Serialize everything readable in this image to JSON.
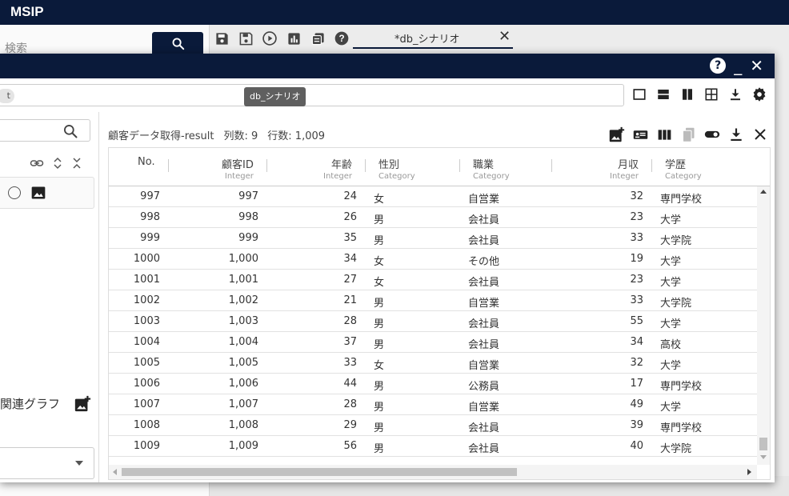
{
  "app": {
    "title": "MSIP"
  },
  "background": {
    "search_label": "検索",
    "tab": {
      "label": "*db_シナリオ",
      "close": "✕"
    }
  },
  "dialog": {
    "tooltip": "db_シナリオ",
    "breadcrumb_chip": "t",
    "header": {
      "help": "?",
      "minimize": "_",
      "close": "✕"
    },
    "left_panel": {
      "graph_label": "関連グラフ"
    },
    "result": {
      "name": "顧客データ取得-result",
      "columns_count": "列数: 9",
      "rows_count": "行数: 1,009"
    },
    "table": {
      "columns": [
        {
          "name": "No.",
          "type": ""
        },
        {
          "name": "顧客ID",
          "type": "Integer"
        },
        {
          "name": "年齢",
          "type": "Integer"
        },
        {
          "name": "性別",
          "type": "Category"
        },
        {
          "name": "職業",
          "type": "Category"
        },
        {
          "name": "月収",
          "type": "Integer"
        },
        {
          "name": "学歴",
          "type": "Category"
        }
      ],
      "rows": [
        [
          "997",
          "997",
          "24",
          "女",
          "自営業",
          "32",
          "専門学校"
        ],
        [
          "998",
          "998",
          "26",
          "男",
          "会社員",
          "23",
          "大学"
        ],
        [
          "999",
          "999",
          "35",
          "男",
          "会社員",
          "33",
          "大学院"
        ],
        [
          "1000",
          "1,000",
          "34",
          "女",
          "その他",
          "19",
          "大学"
        ],
        [
          "1001",
          "1,001",
          "27",
          "女",
          "会社員",
          "23",
          "大学"
        ],
        [
          "1002",
          "1,002",
          "21",
          "男",
          "自営業",
          "33",
          "大学院"
        ],
        [
          "1003",
          "1,003",
          "28",
          "男",
          "会社員",
          "55",
          "大学"
        ],
        [
          "1004",
          "1,004",
          "37",
          "男",
          "会社員",
          "34",
          "高校"
        ],
        [
          "1005",
          "1,005",
          "33",
          "女",
          "自営業",
          "32",
          "大学"
        ],
        [
          "1006",
          "1,006",
          "44",
          "男",
          "公務員",
          "17",
          "専門学校"
        ],
        [
          "1007",
          "1,007",
          "28",
          "男",
          "自営業",
          "49",
          "大学"
        ],
        [
          "1008",
          "1,008",
          "29",
          "男",
          "会社員",
          "39",
          "専門学校"
        ],
        [
          "1009",
          "1,009",
          "56",
          "男",
          "会社員",
          "40",
          "大学院"
        ]
      ]
    }
  },
  "colors": {
    "navy": "#0a1a3a",
    "tooltip_bg": "#5f5f5f"
  }
}
